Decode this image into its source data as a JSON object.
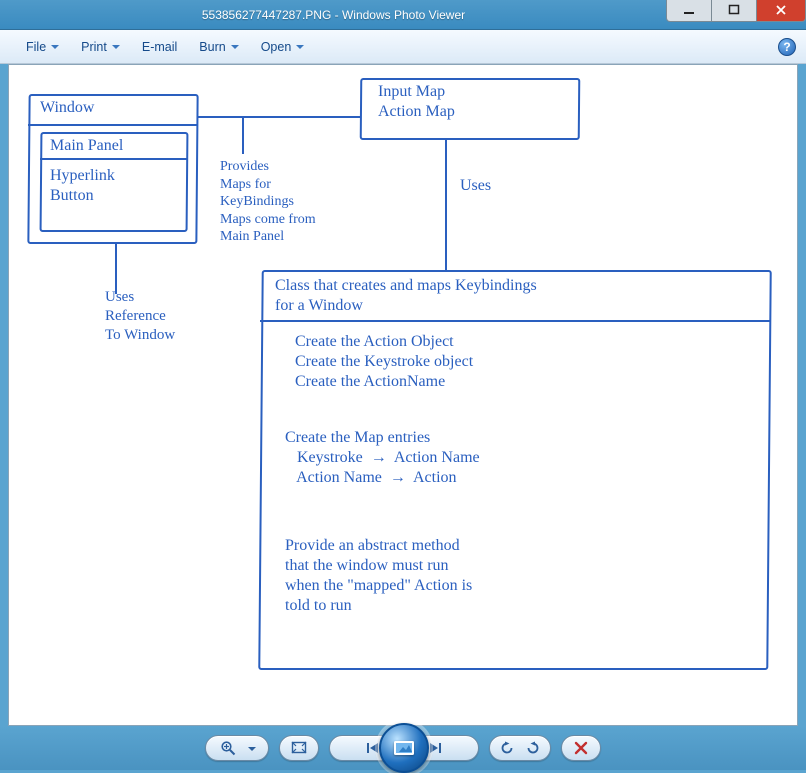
{
  "titlebar": {
    "title": "553856277447287.PNG - Windows Photo Viewer",
    "min_tooltip": "Minimize",
    "max_tooltip": "Maximize",
    "close_tooltip": "Close"
  },
  "menu": {
    "file": "File",
    "print": "Print",
    "email": "E-mail",
    "burn": "Burn",
    "open": "Open",
    "help": "?"
  },
  "player": {
    "zoom_tooltip": "Change the display size",
    "fit_tooltip": "Actual size",
    "prev_tooltip": "Previous (Left arrow)",
    "play_tooltip": "Play slide show (F11)",
    "next_tooltip": "Next (Right arrow)",
    "ccw_tooltip": "Rotate counterclockwise (Ctrl+,)",
    "cw_tooltip": "Rotate clockwise (Ctrl+.)",
    "delete_tooltip": "Delete (Del)"
  },
  "diagram": {
    "window_title": "Window",
    "main_panel": "Main Panel",
    "hyperlink_button": "Hyperlink\nButton",
    "input_action_map": "Input Map\nAction Map",
    "provides_text": "Provides\nMaps for\nKeyBindings\nMaps come from\nMain Panel",
    "uses_label": "Uses",
    "uses_reference": "Uses\nReference\nTo Window",
    "class_title": "Class that creates and maps Keybindings\nfor a Window",
    "steps_block1": "Create the Action Object\nCreate the Keystroke object\nCreate the ActionName",
    "steps_block2": "Create the Map entries\n   Keystroke  →  Action Name\n   Action Name  →  Action",
    "steps_block3": "Provide an abstract method\nthat the window must run\nwhen the \"mapped\" Action is\ntold to run"
  }
}
